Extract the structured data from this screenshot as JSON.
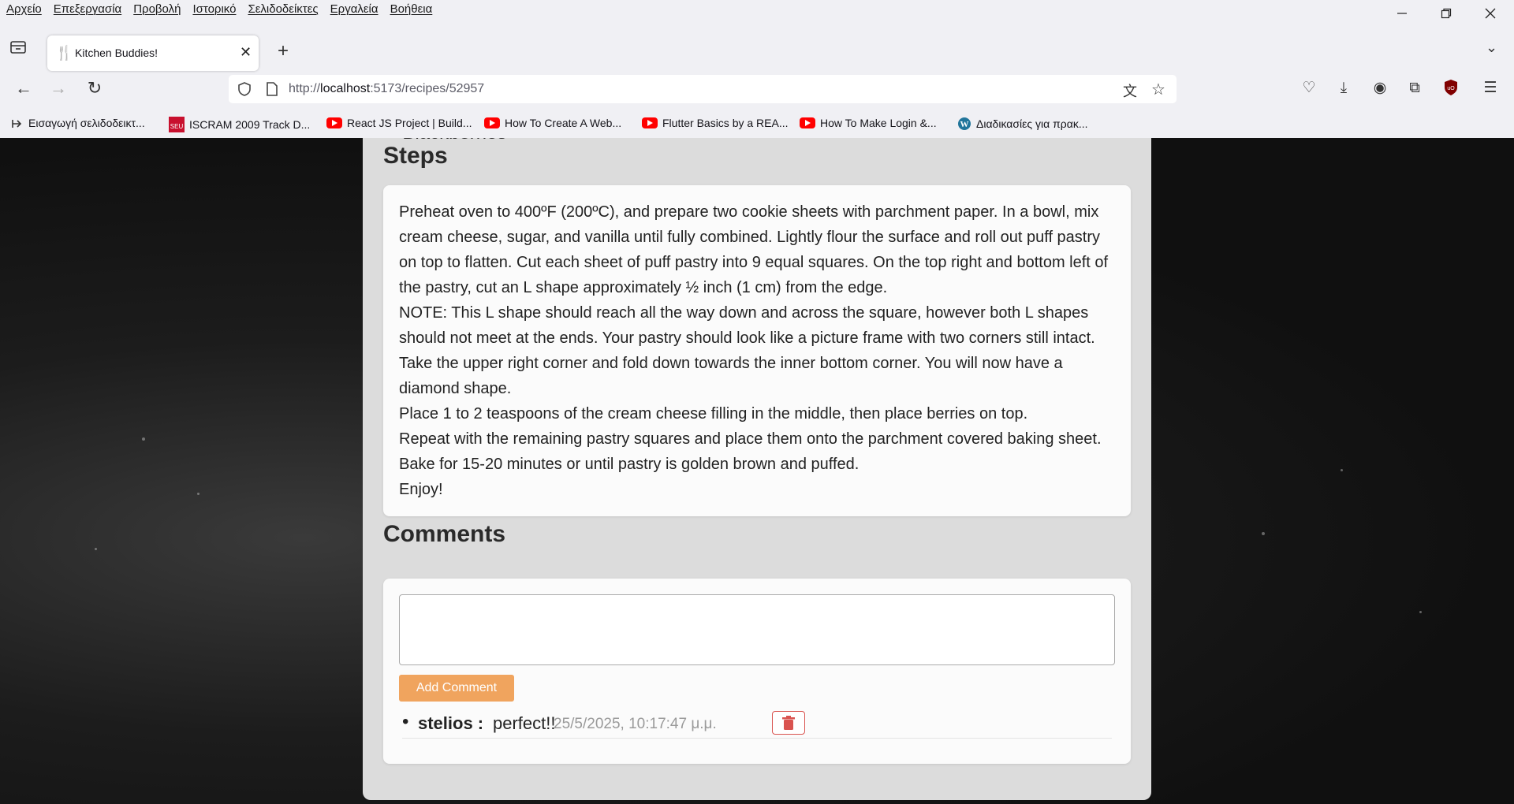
{
  "menu": [
    "Αρχείο",
    "Επεξεργασία",
    "Προβολή",
    "Ιστορικό",
    "Σελιδοδείκτες",
    "Εργαλεία",
    "Βοήθεια"
  ],
  "tab": {
    "title": "Kitchen Buddies!"
  },
  "address": {
    "prefix": "http://",
    "host": "localhost",
    "rest": ":5173/recipes/52957"
  },
  "bookmarks": [
    "Εισαγωγή σελιδοδεικτ...",
    "ISCRAM 2009 Track D...",
    "React JS Project | Build...",
    "How To Create A Web...",
    "Flutter Basics by a REA...",
    "How To Make Login &...",
    "Διαδικασίες για πρακ..."
  ],
  "recipe": {
    "last_ingredient": "Blackberries",
    "steps_heading": "Steps",
    "steps": [
      "Preheat oven to 400ºF (200ºC), and prepare two cookie sheets with parchment paper. In a bowl, mix cream cheese, sugar, and vanilla until fully combined. Lightly flour the surface and roll out puff pastry on top to flatten. Cut each sheet of puff pastry into 9 equal squares. On the top right and bottom left of the pastry, cut an L shape approximately ½ inch (1 cm) from the edge.",
      "NOTE: This L shape should reach all the way down and across the square, however both L shapes should not meet at the ends. Your pastry should look like a picture frame with two corners still intact.",
      "Take the upper right corner and fold down towards the inner bottom corner. You will now have a diamond shape.",
      "Place 1 to 2 teaspoons of the cream cheese filling in the middle, then place berries on top.",
      "Repeat with the remaining pastry squares and place them onto the parchment covered baking sheet.",
      "Bake for 15-20 minutes or until pastry is golden brown and puffed.",
      "Enjoy!"
    ]
  },
  "comments": {
    "heading": "Comments",
    "textarea_value": "",
    "add_label": "Add Comment",
    "items": [
      {
        "author": "stelios :",
        "text": "perfect!!",
        "date": "25/5/2025, 10:17:47 μ.μ."
      }
    ]
  },
  "colors": {
    "accent_button": "#f0a45e",
    "delete_red": "#d9534f"
  }
}
